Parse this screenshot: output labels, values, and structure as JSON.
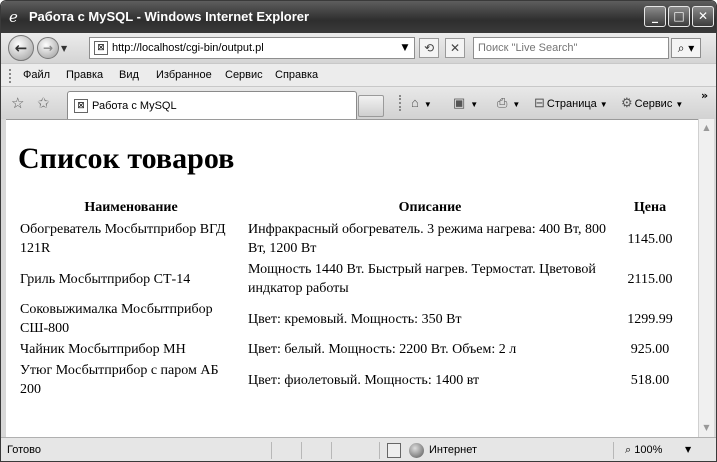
{
  "window": {
    "title": "Работа с MySQL - Windows Internet Explorer"
  },
  "address_bar": {
    "url": "http://localhost/cgi-bin/output.pl"
  },
  "search": {
    "placeholder": "Поиск \"Live Search\""
  },
  "menu": {
    "items": [
      {
        "label": "Файл"
      },
      {
        "label": "Правка"
      },
      {
        "label": "Вид"
      },
      {
        "label": "Избранное"
      },
      {
        "label": "Сервис"
      },
      {
        "label": "Справка"
      }
    ]
  },
  "tab": {
    "label": "Работа с MySQL"
  },
  "command_bar": {
    "page_label": "Страница",
    "tools_label": "Сервис"
  },
  "page": {
    "heading": "Список товаров",
    "table": {
      "headers": [
        "Наименование",
        "Описание",
        "Цена"
      ],
      "rows": [
        {
          "name": "Обогреватель Мосбытприбор ВГД 121R",
          "description": "Инфракрасный обогреватель. 3 режима нагрева: 400 Вт, 800 Вт, 1200 Вт",
          "price": "1145.00"
        },
        {
          "name": "Гриль Мосбытприбор СТ-14",
          "description": "Мощность 1440 Вт. Быстрый нагрев. Термостат. Цветовой индкатор работы",
          "price": "2115.00"
        },
        {
          "name": "Соковыжималка Мосбытприбор СШ-800",
          "description": "Цвет: кремовый. Мощность: 350 Вт",
          "price": "1299.99"
        },
        {
          "name": "Чайник Мосбытприбор МН",
          "description": "Цвет: белый. Мощность: 2200 Вт. Объем: 2 л",
          "price": "925.00"
        },
        {
          "name": "Утюг Мосбытприбор с паром АБ 200",
          "description": "Цвет: фиолетовый. Мощность: 1400 вт",
          "price": "518.00"
        }
      ]
    }
  },
  "status_bar": {
    "status": "Готово",
    "zone": "Интернет",
    "zoom": "100%"
  }
}
